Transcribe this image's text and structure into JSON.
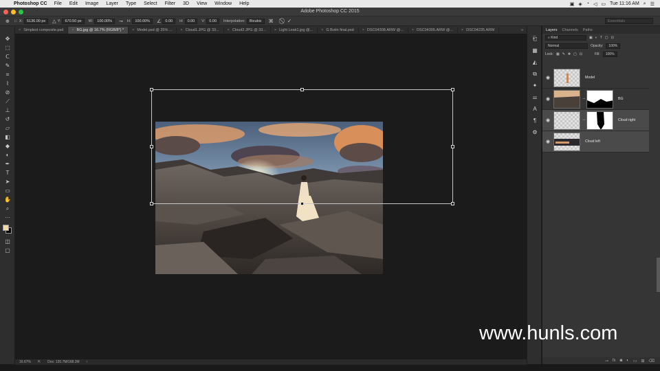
{
  "menubar": {
    "app": "Photoshop CC",
    "items": [
      "File",
      "Edit",
      "Image",
      "Layer",
      "Type",
      "Select",
      "Filter",
      "3D",
      "View",
      "Window",
      "Help"
    ],
    "clock": "Tue 11:16 AM"
  },
  "window": {
    "title": "Adobe Photoshop CC 2015"
  },
  "options": {
    "x_label": "X:",
    "x_value": "5136.00 px",
    "y_label": "Y:",
    "y_value": "670.50 px",
    "w_label": "W:",
    "w_value": "100.00%",
    "h_label": "H:",
    "h_value": "100.00%",
    "angle_value": "0.00",
    "hskew_label": "H:",
    "hskew_value": "0.00",
    "vskew_label": "V:",
    "vskew_value": "0.00",
    "interp_label": "Interpolation:",
    "interp_value": "Bicubic",
    "cancel_symbol": "⃠",
    "commit_symbol": "✓",
    "workspace": "Essentials"
  },
  "tabs": [
    {
      "label": "Simplest composite.psd",
      "active": false
    },
    {
      "label": "BG.jpg @ 16.7% (RGB/8*) *",
      "active": true
    },
    {
      "label": "Model.psd @ 25% ...",
      "active": false
    },
    {
      "label": "Cloud1.JPG @ 33...",
      "active": false
    },
    {
      "label": "Cloud2.JPG @ 33...",
      "active": false
    },
    {
      "label": "Light Leak1.jpg @...",
      "active": false
    },
    {
      "label": "G Botin final.psd",
      "active": false
    },
    {
      "label": "DSC04308.ARW @...",
      "active": false
    },
    {
      "label": "DSC04305.ARW @...",
      "active": false
    },
    {
      "label": "DSC04235.ARW",
      "active": false
    }
  ],
  "tabs_more": "»",
  "status": {
    "zoom": "16.67%",
    "doc": "Doc: 120.7M/168.2M"
  },
  "layers_panel": {
    "tabs": [
      "Layers",
      "Channels",
      "Paths"
    ],
    "kind": "Kind",
    "blend_mode": "Normal",
    "opacity_label": "Opacity:",
    "opacity_value": "100%",
    "lock_label": "Lock:",
    "fill_label": "Fill:",
    "fill_value": "100%",
    "layers": [
      {
        "name": "Model",
        "selected": false
      },
      {
        "name": "BG",
        "selected": false
      },
      {
        "name": "Cloud right",
        "selected": true
      },
      {
        "name": "Cloud left",
        "selected": true
      }
    ]
  },
  "watermark": "www.hunls.com"
}
